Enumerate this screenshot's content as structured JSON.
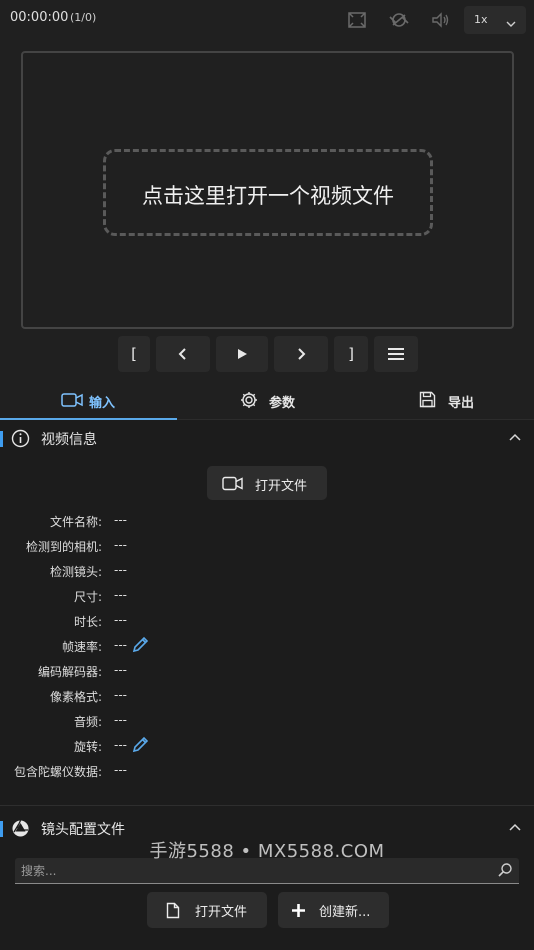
{
  "player": {
    "time": "00:00:00",
    "frame_counter": "(1/0)",
    "speed": "1x",
    "drop_prompt": "点击这里打开一个视频文件",
    "controls": {
      "mark_in": "[",
      "prev": "prev-icon",
      "play": "play-icon",
      "next": "next-icon",
      "mark_out": "]",
      "menu": "menu-icon"
    }
  },
  "tabs": [
    {
      "label": "输入",
      "icon": "video-camera-icon",
      "active": true
    },
    {
      "label": "参数",
      "icon": "gear-icon",
      "active": false
    },
    {
      "label": "导出",
      "icon": "save-icon",
      "active": false
    }
  ],
  "video_info": {
    "title": "视频信息",
    "open_button": "打开文件",
    "fields": [
      {
        "label": "文件名称:",
        "value": "---"
      },
      {
        "label": "检测到的相机:",
        "value": "---"
      },
      {
        "label": "检测镜头:",
        "value": "---"
      },
      {
        "label": "尺寸:",
        "value": "---"
      },
      {
        "label": "时长:",
        "value": "---"
      },
      {
        "label": "帧速率:",
        "value": "---",
        "editable": true
      },
      {
        "label": "编码解码器:",
        "value": "---"
      },
      {
        "label": "像素格式:",
        "value": "---"
      },
      {
        "label": "音频:",
        "value": "---"
      },
      {
        "label": "旋转:",
        "value": "---",
        "editable": true
      },
      {
        "label": "包含陀螺仪数据:",
        "value": "---"
      }
    ]
  },
  "lens_profile": {
    "title": "镜头配置文件",
    "search_placeholder": "搜索...",
    "open_button": "打开文件",
    "create_button": "创建新..."
  },
  "watermark": "手游5588 • MX5588.COM",
  "colors": {
    "accent": "#3f9df0",
    "active_tab_text": "#7fc3ff",
    "background": "#202020",
    "panel": "#1c1c1c",
    "button": "#2d2d2d"
  }
}
